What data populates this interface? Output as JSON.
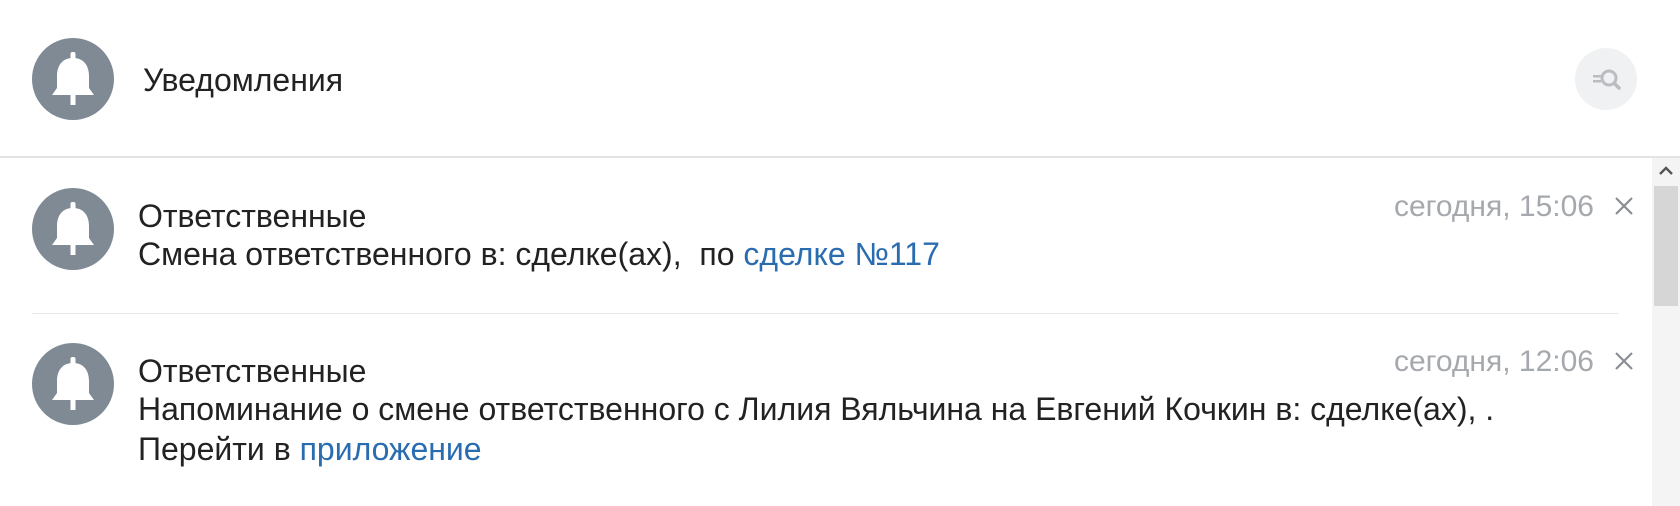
{
  "header": {
    "title": "Уведомления",
    "avatar_icon": "bell-icon",
    "search_icon": "filter-search-icon"
  },
  "notifications": [
    {
      "icon": "bell-icon",
      "title": "Ответственные",
      "text_prefix": "Смена ответственного в: сделке(ах),  по ",
      "link": "сделке №117",
      "text_suffix": "",
      "time": "сегодня, 15:06",
      "close_icon": "close-icon"
    },
    {
      "icon": "bell-icon",
      "title": "Ответственные",
      "text_prefix": "Напоминание о смене ответственного с Лилия Вяльчина на Евгений Кочкин в: сделке(ах), .\nПерейти в ",
      "link": "приложение",
      "text_suffix": "",
      "time": "сегодня, 12:06",
      "close_icon": "close-icon"
    }
  ],
  "colors": {
    "avatar": "#7f8a95",
    "link": "#2a6cb0",
    "time": "#a5a9ad"
  }
}
